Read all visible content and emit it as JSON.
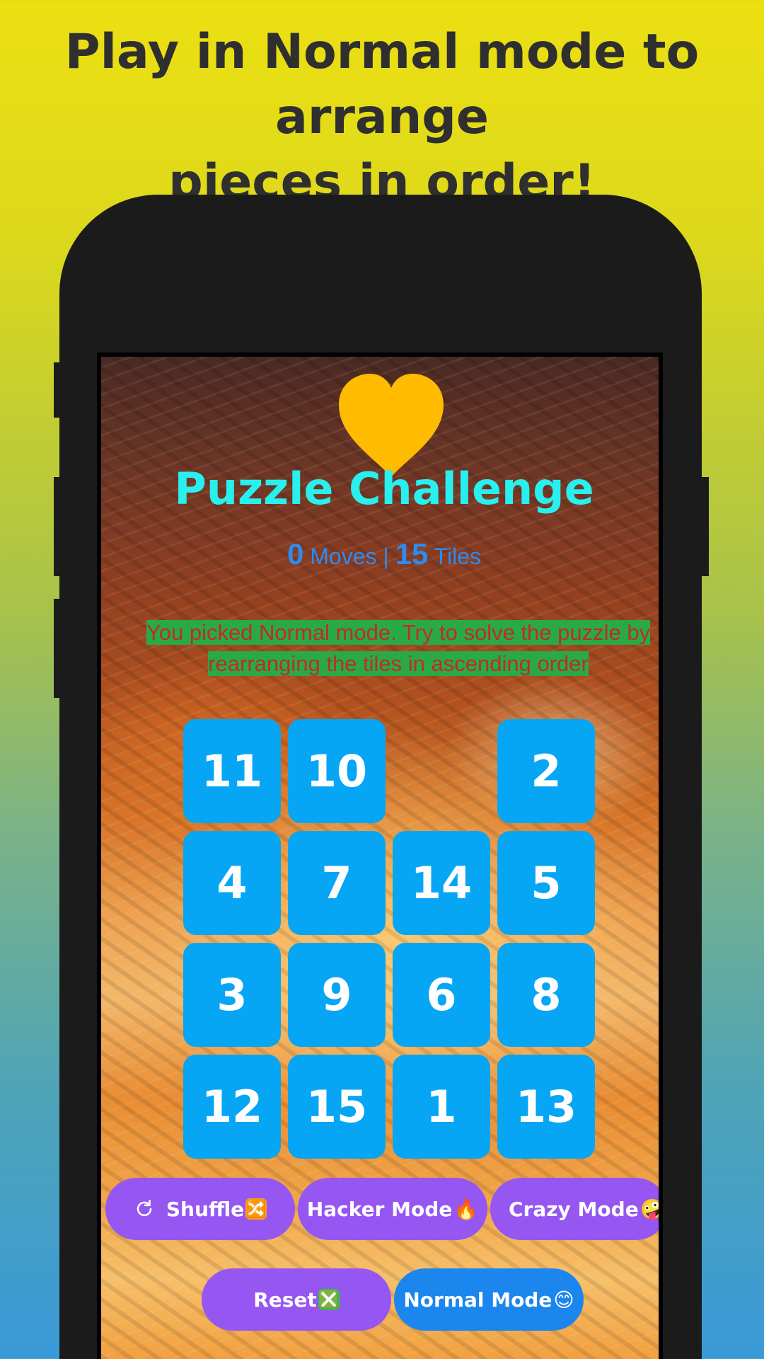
{
  "promo": {
    "headline": "Play in Normal mode to arrange\npieces in order!"
  },
  "app": {
    "logo_icon": "heart-icon",
    "title": "Puzzle Challenge",
    "stats": {
      "moves": "0",
      "moves_label": " Moves | ",
      "tiles": "15",
      "tiles_label": " Tiles"
    },
    "message": "You picked Normal mode. Try to solve the puzzle by rearranging the tiles in ascending order"
  },
  "board": {
    "rows": [
      [
        "11",
        "10",
        "",
        "2"
      ],
      [
        "4",
        "7",
        "14",
        "5"
      ],
      [
        "3",
        "9",
        "6",
        "8"
      ],
      [
        "12",
        "15",
        "1",
        "13"
      ]
    ]
  },
  "buttons": {
    "shuffle": "Shuffle",
    "hacker_mode": "Hacker Mode",
    "crazy_mode": "Crazy Mode",
    "reset": "Reset",
    "normal_mode": "Normal Mode",
    "emoji": {
      "shuffle": "🔀",
      "hacker": "🔥",
      "crazy": "🤪",
      "reset": "❎",
      "normal": "😊"
    }
  },
  "colors": {
    "tile": "#06a6f5",
    "title": "#27f0ee",
    "button_purple": "#9556f2",
    "button_blue": "#1a86ee",
    "message_text": "#c02b2b",
    "message_highlight": "#2aaa44",
    "heart": "#ffbb00"
  }
}
